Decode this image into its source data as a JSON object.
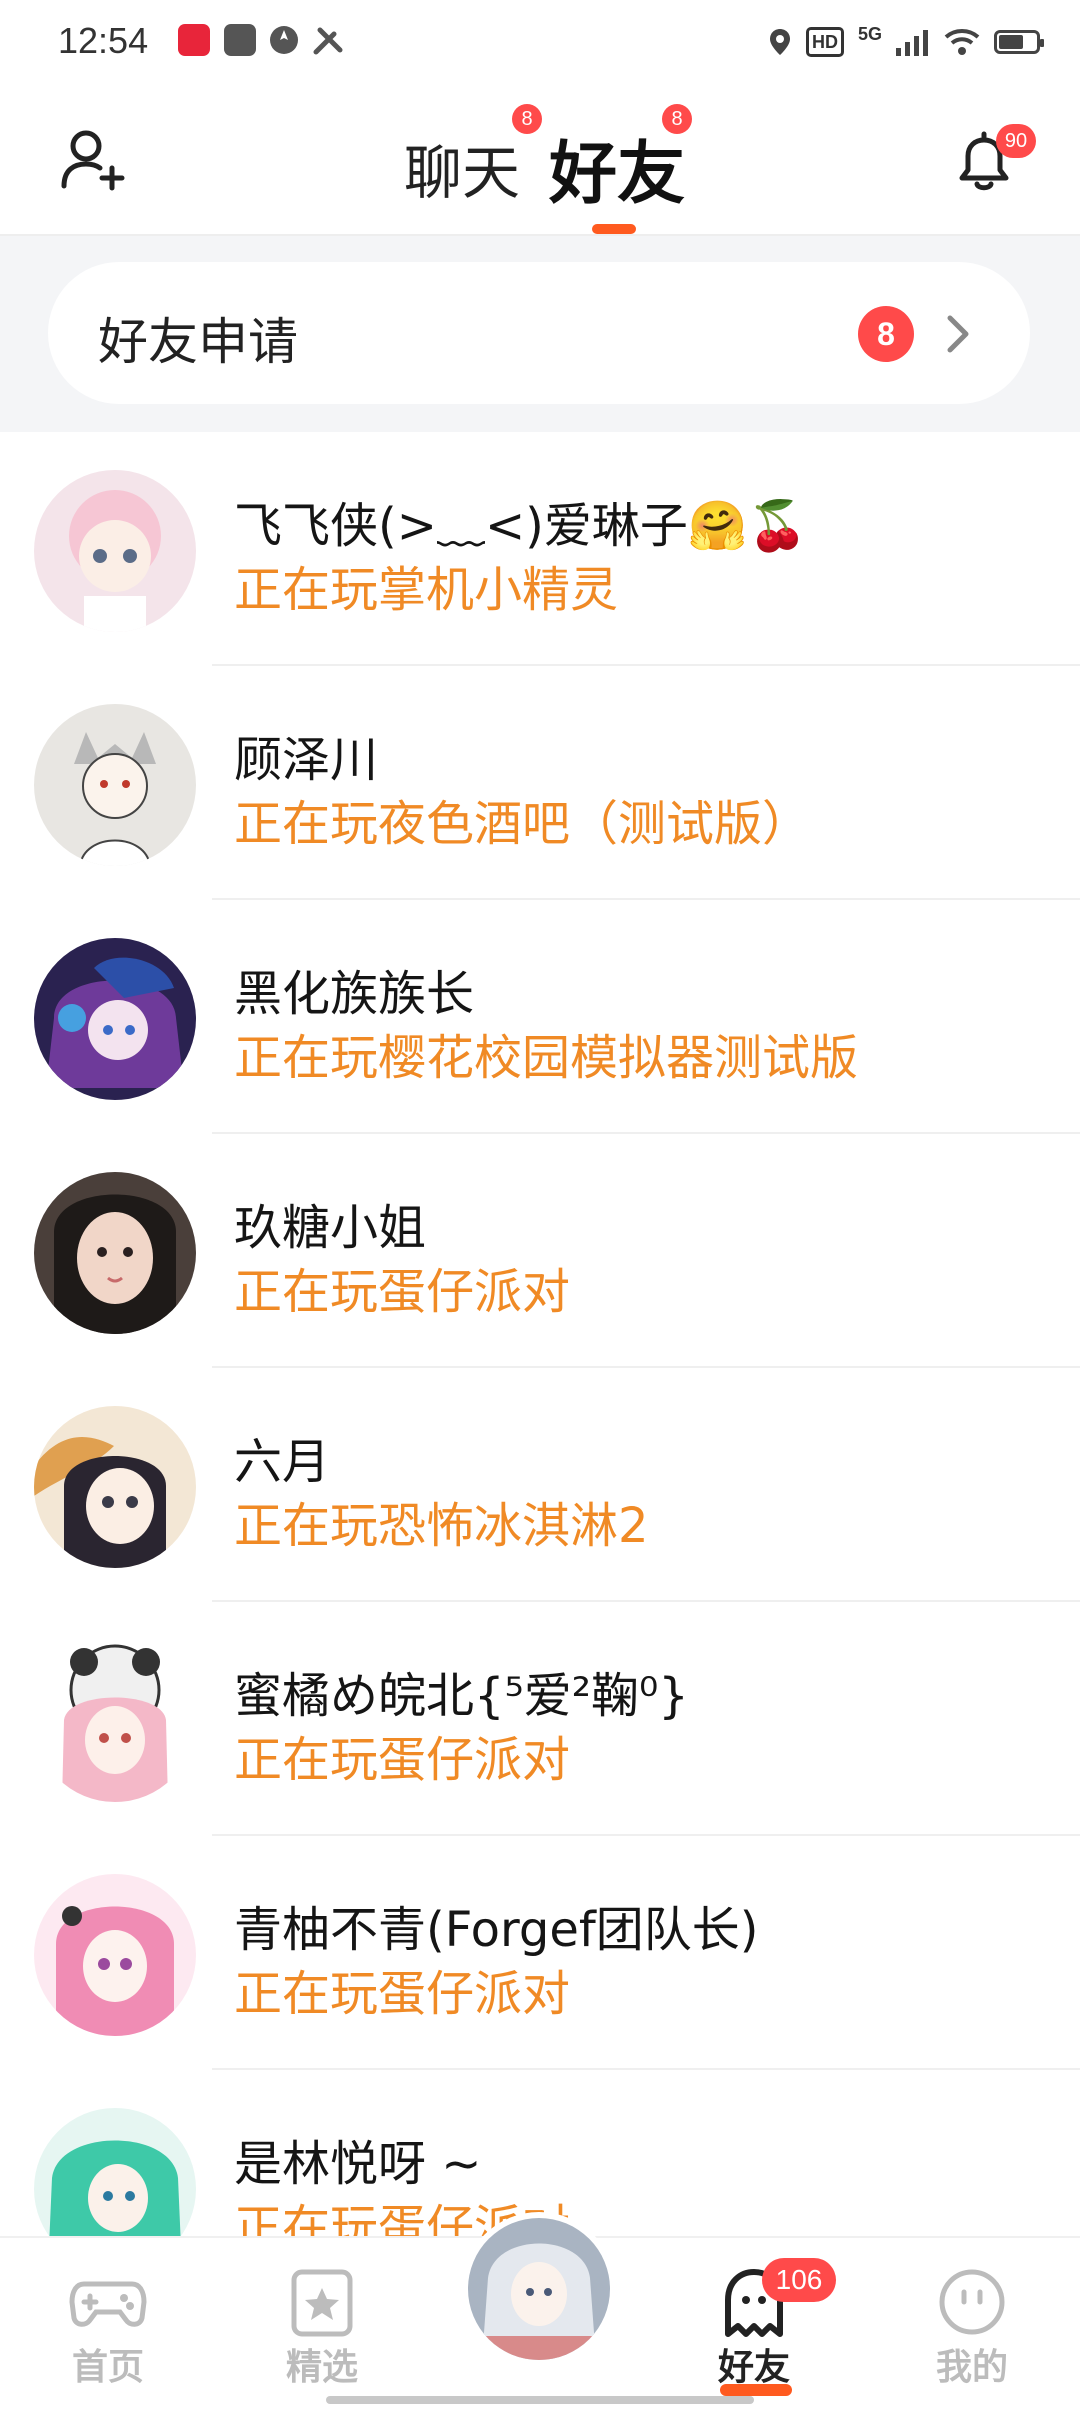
{
  "status_bar": {
    "time": "12:54",
    "hd_label": "HD",
    "network_label": "5G",
    "colors": {
      "app1": "#e8253a",
      "app2": "#555555"
    }
  },
  "header": {
    "tabs": [
      {
        "label": "聊天",
        "badge": "8"
      },
      {
        "label": "好友",
        "badge": "8",
        "active": true
      }
    ],
    "notification_badge": "90",
    "accent_color": "#ff5a1f"
  },
  "friend_requests": {
    "label": "好友申请",
    "badge": "8"
  },
  "friends": [
    {
      "name": "飞飞侠(>﹏<)爱琳子🤗🍒",
      "status": "正在玩掌机小精灵"
    },
    {
      "name": "顾泽川",
      "status": "正在玩夜色酒吧（测试版）"
    },
    {
      "name": "黑化族族长",
      "status": "正在玩樱花校园模拟器测试版"
    },
    {
      "name": "玖糖小姐",
      "status": "正在玩蛋仔派对"
    },
    {
      "name": "六月",
      "status": "正在玩恐怖冰淇淋2"
    },
    {
      "name": "蜜橘め皖北{⁵爱²鞠⁰}",
      "status": "正在玩蛋仔派对"
    },
    {
      "name": "青柚不青(Forgef团队长)",
      "status": "正在玩蛋仔派对"
    },
    {
      "name": "是林悦呀 ~",
      "status": "正在玩蛋仔派对"
    }
  ],
  "bottom_nav": {
    "items": [
      {
        "label": "首页",
        "icon": "gamepad-icon"
      },
      {
        "label": "精选",
        "icon": "star-card-icon"
      },
      {
        "label": "",
        "icon": "profile-avatar"
      },
      {
        "label": "好友",
        "icon": "ghost-icon",
        "active": true,
        "badge": "106"
      },
      {
        "label": "我的",
        "icon": "smiley-face-icon"
      }
    ]
  },
  "colors": {
    "status_text": "#f08a25",
    "badge": "#ff4a4a",
    "accent": "#ff5a1f"
  }
}
